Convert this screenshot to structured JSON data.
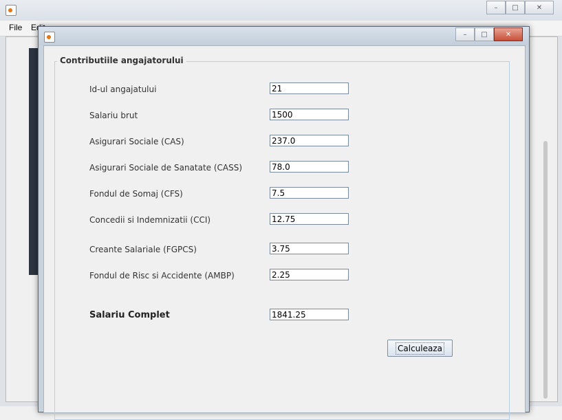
{
  "main_window": {
    "menu": [
      "File",
      "Edit"
    ]
  },
  "dialog": {
    "group_title": "Contributiile angajatorului",
    "fields": [
      {
        "label": "Id-ul angajatului",
        "value": "21"
      },
      {
        "label": "Salariu brut",
        "value": "1500"
      },
      {
        "label": "Asigurari Sociale (CAS)",
        "value": "237.0"
      },
      {
        "label": "Asigurari Sociale de Sanatate (CASS)",
        "value": "78.0"
      },
      {
        "label": "Fondul de Somaj (CFS)",
        "value": "7.5"
      },
      {
        "label": "Concedii si Indemnizatii (CCI)",
        "value": "12.75"
      },
      {
        "label": "Creante Salariale (FGPCS)",
        "value": "3.75"
      },
      {
        "label": "Fondul de Risc si Accidente (AMBP)",
        "value": "2.25"
      }
    ],
    "total": {
      "label": "Salariu Complet",
      "value": "1841.25"
    },
    "calculate_button": "Calculeaza"
  },
  "icons": {
    "app": "java-cup-icon",
    "minimize": "minimize-icon",
    "maximize": "maximize-icon",
    "close": "close-icon"
  },
  "colors": {
    "close_button": "#c7503a",
    "group_border": "#b8cfe5",
    "window_bg": "#f0f0f0"
  }
}
